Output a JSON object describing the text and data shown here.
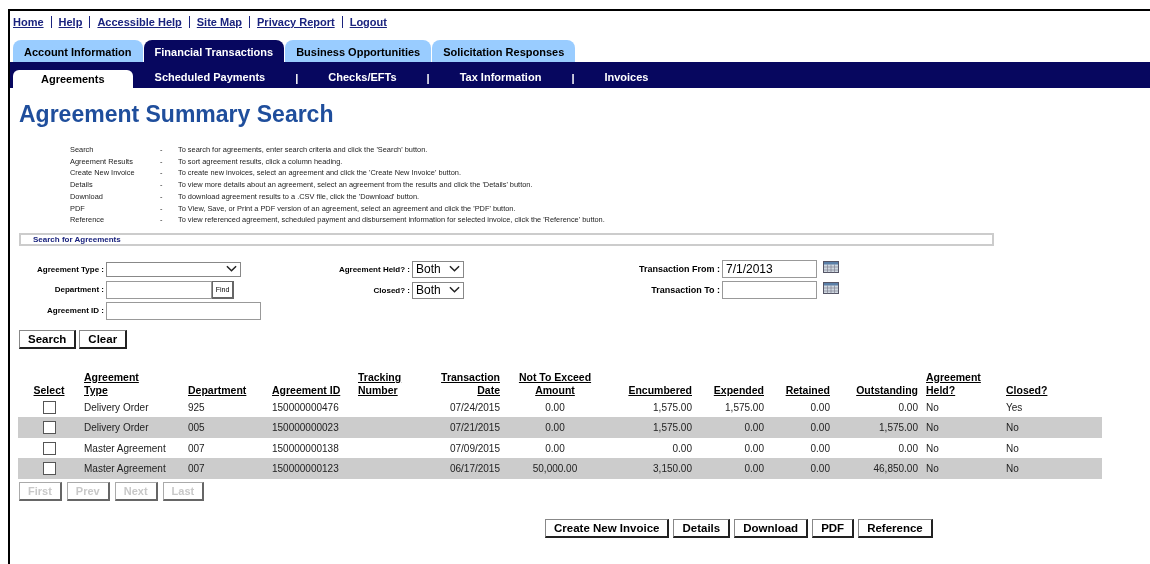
{
  "top_links": [
    "Home",
    "Help",
    "Accessible Help",
    "Site Map",
    "Privacy Report",
    "Logout"
  ],
  "tabs": [
    {
      "label": "Account Information",
      "selected": false
    },
    {
      "label": "Financial Transactions",
      "selected": true
    },
    {
      "label": "Business Opportunities",
      "selected": false
    },
    {
      "label": "Solicitation Responses",
      "selected": false
    }
  ],
  "subtabs": [
    {
      "label": "Agreements",
      "selected": true
    },
    {
      "label": "Scheduled Payments",
      "selected": false
    },
    {
      "label": "Checks/EFTs",
      "selected": false
    },
    {
      "label": "Tax Information",
      "selected": false
    },
    {
      "label": "Invoices",
      "selected": false
    }
  ],
  "subtab_separator": "|",
  "title": "Agreement Summary Search",
  "help": [
    {
      "term": "Search",
      "dash": "-",
      "text": "To search for agreements, enter search criteria and click the 'Search' button."
    },
    {
      "term": "Agreement Results",
      "dash": "-",
      "text": "To sort agreement results, click a column heading."
    },
    {
      "term": "Create New Invoice",
      "dash": "-",
      "text": "To create new invoices, select an agreement and click the 'Create New Invoice' button."
    },
    {
      "term": "Details",
      "dash": "-",
      "text": "To view more details about an agreement, select an agreement from the results and click the 'Details' button."
    },
    {
      "term": "Download",
      "dash": "-",
      "text": "To download agreement results to a .CSV file, click the 'Download' button."
    },
    {
      "term": "PDF",
      "dash": "-",
      "text": "To View, Save, or Print a PDF version of an agreement, select an agreement and click the 'PDF' button."
    },
    {
      "term": "Reference",
      "dash": "-",
      "text": "To view referenced agreement, scheduled payment and disbursement information for selected invoice, click the 'Reference' button."
    }
  ],
  "search_section": "Search for Agreements",
  "form": {
    "left": [
      {
        "kind": "select",
        "label": "Agreement Type :"
      },
      {
        "kind": "lookup",
        "label": "Department :",
        "button": "Find"
      },
      {
        "kind": "text",
        "label": "Agreement ID :"
      }
    ],
    "middle": [
      {
        "kind": "select",
        "label": "Agreement Held? :",
        "value": "Both"
      },
      {
        "kind": "select",
        "label": "Closed? :",
        "value": "Both"
      }
    ],
    "right": [
      {
        "kind": "date",
        "label": "Transaction From :",
        "value": "7/1/2013"
      },
      {
        "kind": "date",
        "label": "Transaction To :"
      }
    ]
  },
  "form_buttons": [
    "Search",
    "Clear"
  ],
  "table": {
    "select_heading": "Select",
    "columns": [
      "Agreement Type",
      "Department",
      "Agreement ID",
      "Tracking Number",
      "Transaction Date",
      "Not To Exceed Amount",
      "Encumbered",
      "Expended",
      "Retained",
      "Outstanding",
      "Agreement Held?",
      "Closed?"
    ],
    "rows": [
      {
        "checked": false,
        "cells": [
          "Delivery Order",
          "925",
          "150000000476",
          "",
          "07/24/2015",
          "0.00",
          "1,575.00",
          "1,575.00",
          "0.00",
          "0.00",
          "No",
          "Yes"
        ]
      },
      {
        "checked": false,
        "cells": [
          "Delivery Order",
          "005",
          "150000000023",
          "",
          "07/21/2015",
          "0.00",
          "1,575.00",
          "0.00",
          "0.00",
          "1,575.00",
          "No",
          "No"
        ]
      },
      {
        "checked": false,
        "cells": [
          "Master Agreement",
          "007",
          "150000000138",
          "",
          "07/09/2015",
          "0.00",
          "0.00",
          "0.00",
          "0.00",
          "0.00",
          "No",
          "No"
        ]
      },
      {
        "checked": false,
        "cells": [
          "Master Agreement",
          "007",
          "150000000123",
          "",
          "06/17/2015",
          "50,000.00",
          "3,150.00",
          "0.00",
          "0.00",
          "46,850.00",
          "No",
          "No"
        ]
      }
    ]
  },
  "pager": [
    {
      "label": "First",
      "disabled": true
    },
    {
      "label": "Prev",
      "disabled": true
    },
    {
      "label": "Next",
      "disabled": true
    },
    {
      "label": "Last",
      "disabled": true
    }
  ],
  "actions": [
    "Create New Invoice",
    "Details",
    "Download",
    "PDF",
    "Reference"
  ]
}
